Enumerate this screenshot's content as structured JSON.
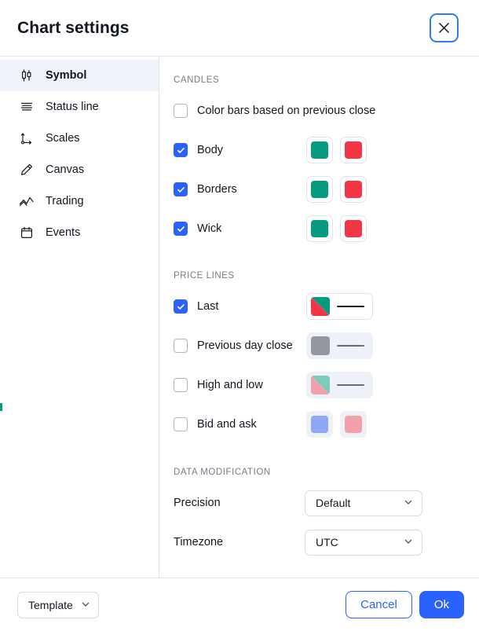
{
  "header": {
    "title": "Chart settings",
    "close_icon": "close-icon"
  },
  "sidebar": {
    "items": [
      {
        "label": "Symbol",
        "icon": "candlestick-icon",
        "active": true
      },
      {
        "label": "Status line",
        "icon": "status-line-icon",
        "active": false
      },
      {
        "label": "Scales",
        "icon": "scales-axes-icon",
        "active": false
      },
      {
        "label": "Canvas",
        "icon": "pencil-icon",
        "active": false
      },
      {
        "label": "Trading",
        "icon": "trading-zigzag-icon",
        "active": false
      },
      {
        "label": "Events",
        "icon": "calendar-icon",
        "active": false
      }
    ]
  },
  "sections": {
    "candles": {
      "title": "CANDLES",
      "color_bars": {
        "label": "Color bars based on previous close",
        "checked": false
      },
      "rows": [
        {
          "label": "Body",
          "checked": true,
          "up_color": "#089981",
          "down_color": "#f23645"
        },
        {
          "label": "Borders",
          "checked": true,
          "up_color": "#089981",
          "down_color": "#f23645"
        },
        {
          "label": "Wick",
          "checked": true,
          "up_color": "#089981",
          "down_color": "#f23645"
        }
      ]
    },
    "price_lines": {
      "title": "PRICE LINES",
      "rows": [
        {
          "label": "Last",
          "checked": true,
          "style": "split-line",
          "color_a": "#f23645",
          "color_b": "#089981",
          "line_color": "#131722"
        },
        {
          "label": "Previous day close",
          "checked": false,
          "style": "solid-line",
          "color_a": "#9598a1",
          "color_b": "#9598a1",
          "line_color": "#6a6d78"
        },
        {
          "label": "High and low",
          "checked": false,
          "style": "split-line",
          "color_a": "#f2a1ab",
          "color_b": "#7dccb9",
          "line_color": "#6a6d78"
        },
        {
          "label": "Bid and ask",
          "checked": false,
          "style": "two-chips",
          "color_a": "#8fa7f5",
          "color_b": "#f2a1ab"
        }
      ]
    },
    "data_modification": {
      "title": "DATA MODIFICATION",
      "rows": [
        {
          "label": "Precision",
          "value": "Default",
          "chevron": "chevron-down-icon"
        },
        {
          "label": "Timezone",
          "value": "UTC",
          "chevron": "chevron-down-icon"
        }
      ]
    }
  },
  "footer": {
    "template_label": "Template",
    "template_chevron": "chevron-down-icon",
    "cancel_label": "Cancel",
    "ok_label": "Ok"
  },
  "colors": {
    "accent": "#2962ff",
    "up": "#089981",
    "down": "#f23645",
    "edge_accent": "#089981"
  }
}
